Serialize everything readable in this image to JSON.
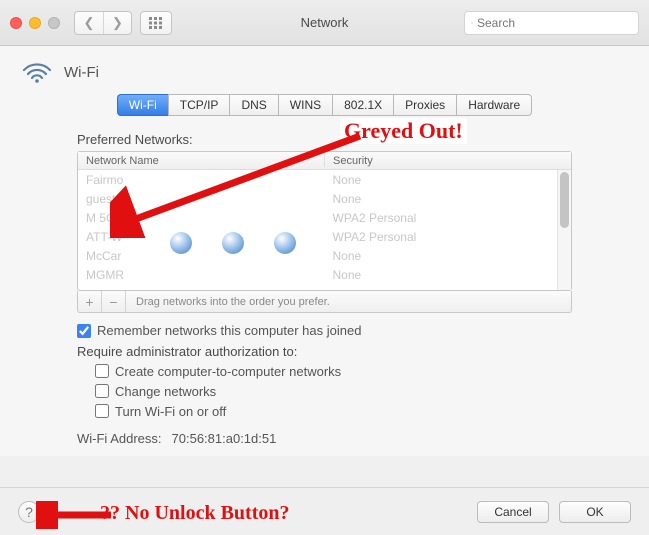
{
  "titlebar": {
    "title": "Network",
    "search_placeholder": "Search"
  },
  "header": {
    "label": "Wi-Fi"
  },
  "tabs": {
    "items": [
      {
        "label": "Wi-Fi",
        "active": true
      },
      {
        "label": "TCP/IP",
        "active": false
      },
      {
        "label": "DNS",
        "active": false
      },
      {
        "label": "WINS",
        "active": false
      },
      {
        "label": "802.1X",
        "active": false
      },
      {
        "label": "Proxies",
        "active": false
      },
      {
        "label": "Hardware",
        "active": false
      }
    ]
  },
  "preferred": {
    "label": "Preferred Networks:",
    "columns": {
      "name": "Network Name",
      "security": "Security"
    },
    "rows": [
      {
        "name": "Fairmo",
        "security": "None"
      },
      {
        "name": "guest-",
        "security": "None"
      },
      {
        "name": "M 5GH",
        "security": "WPA2 Personal"
      },
      {
        "name": "ATT-W",
        "security": "WPA2 Personal"
      },
      {
        "name": "McCar",
        "security": "None"
      },
      {
        "name": "MGMR",
        "security": "None"
      }
    ],
    "hint": "Drag networks into the order you prefer."
  },
  "remember": {
    "checked": true,
    "label": "Remember networks this computer has joined"
  },
  "auth": {
    "label": "Require administrator authorization to:",
    "options": [
      {
        "label": "Create computer-to-computer networks",
        "checked": false
      },
      {
        "label": "Change networks",
        "checked": false
      },
      {
        "label": "Turn Wi-Fi on or off",
        "checked": false
      }
    ]
  },
  "address": {
    "label": "Wi-Fi Address:",
    "value": "70:56:81:a0:1d:51"
  },
  "footer": {
    "cancel": "Cancel",
    "ok": "OK"
  },
  "annotations": {
    "greyed": "Greyed Out!",
    "no_unlock": "?? No Unlock Button?"
  }
}
